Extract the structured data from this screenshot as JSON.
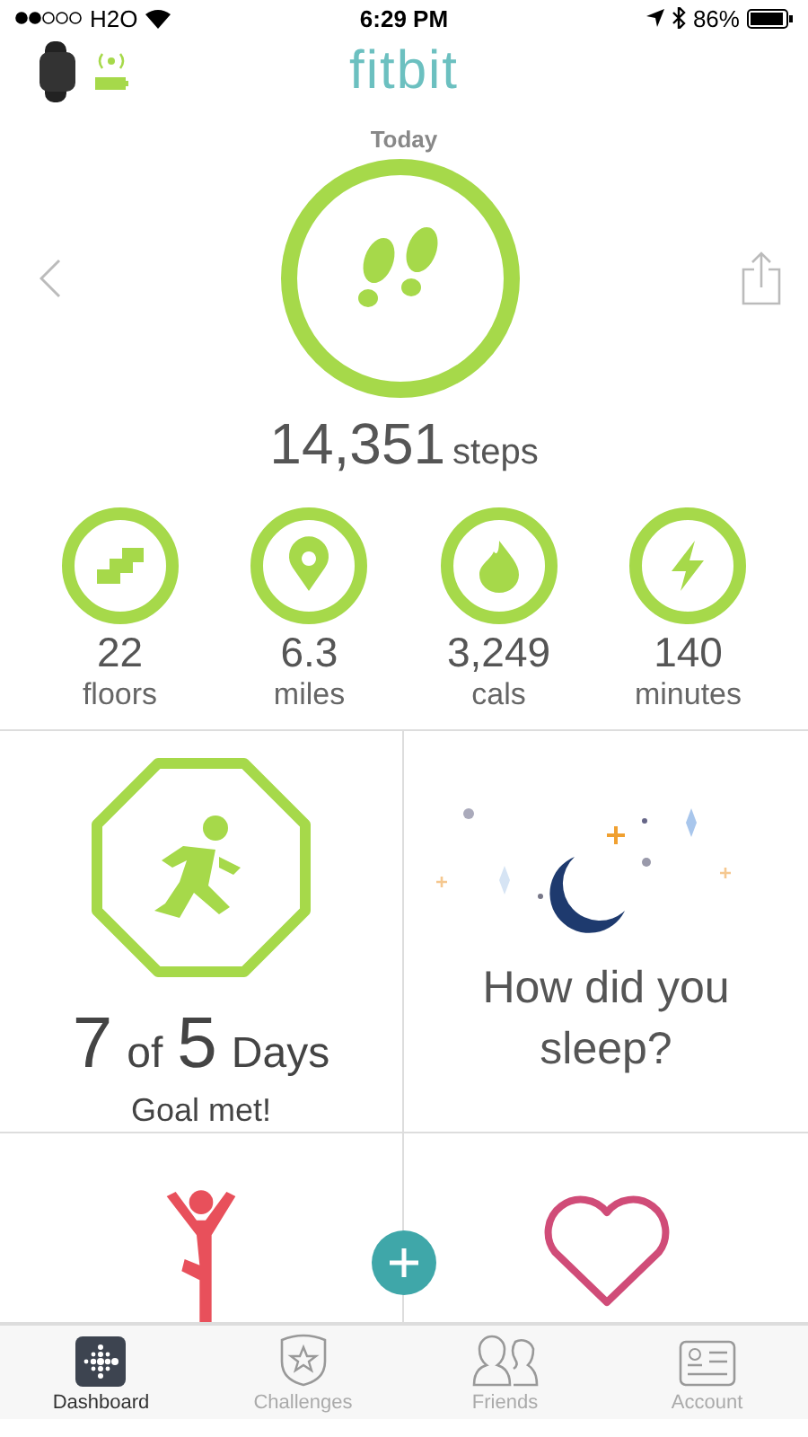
{
  "status_bar": {
    "carrier": "H2O",
    "time": "6:29 PM",
    "battery": "86%"
  },
  "header": {
    "logo": "fitbit",
    "date": "Today"
  },
  "steps": {
    "value": "14,351",
    "unit": "steps"
  },
  "stats": [
    {
      "kind": "floors",
      "value": "22",
      "unit": "floors"
    },
    {
      "kind": "distance",
      "value": "6.3",
      "unit": "miles"
    },
    {
      "kind": "calories",
      "value": "3,249",
      "unit": "cals"
    },
    {
      "kind": "active",
      "value": "140",
      "unit": "minutes"
    }
  ],
  "tiles": {
    "exercise": {
      "count": "7",
      "of": "of",
      "goal": "5",
      "unit": "Days",
      "caption": "Goal met!"
    },
    "sleep": {
      "question": "How did you sleep?"
    }
  },
  "tabs": [
    {
      "label": "Dashboard",
      "selected": true
    },
    {
      "label": "Challenges",
      "selected": false
    },
    {
      "label": "Friends",
      "selected": false
    },
    {
      "label": "Account",
      "selected": false
    }
  ]
}
